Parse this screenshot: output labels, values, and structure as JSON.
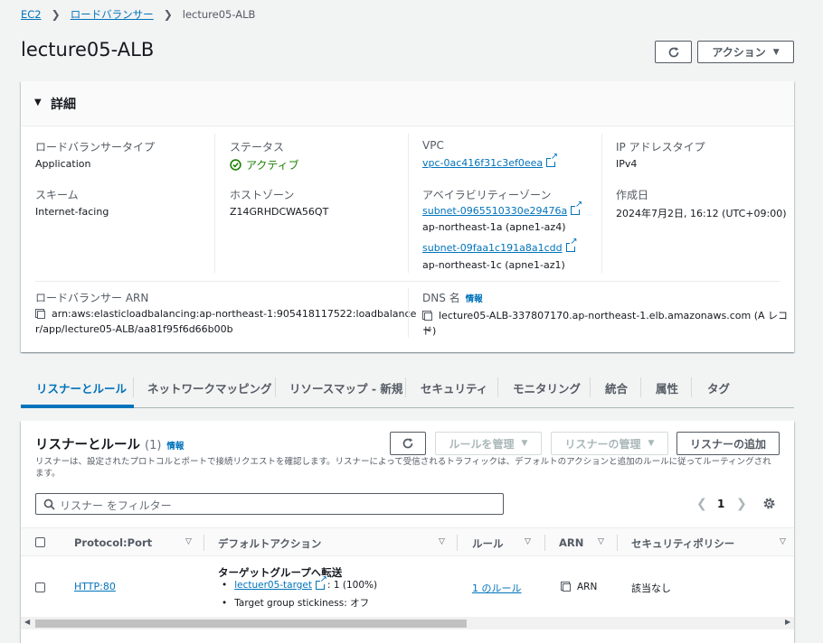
{
  "breadcrumb": {
    "items": [
      "EC2",
      "ロードバランサー"
    ],
    "current": "lecture05-ALB"
  },
  "page": {
    "title": "lecture05-ALB",
    "action_label": "アクション"
  },
  "details": {
    "section_title": "詳細",
    "lb_type_label": "ロードバランサータイプ",
    "lb_type": "Application",
    "status_label": "ステータス",
    "status": "アクティブ",
    "vpc_label": "VPC",
    "vpc": "vpc-0ac416f31c3ef0eea",
    "ip_type_label": "IP アドレスタイプ",
    "ip_type": "IPv4",
    "scheme_label": "スキーム",
    "scheme": "Internet-facing",
    "hosted_zone_label": "ホストゾーン",
    "hosted_zone": "Z14GRHDCWA56QT",
    "az_label": "アベイラビリティーゾーン",
    "subnet1": "subnet-0965510330e29476a",
    "subnet1_az": "ap-northeast-1a (apne1-az4)",
    "subnet2": "subnet-09faa1c191a8a1cdd",
    "subnet2_az": "ap-northeast-1c (apne1-az1)",
    "created_label": "作成日",
    "created": "2024年7月2日, 16:12 (UTC+09:00)",
    "arn_label": "ロードバランサー ARN",
    "arn_line1": "arn:aws:elasticloadbalancing:ap-northeast-1:905418117522:loadbalance",
    "arn_line2": "r/app/lecture05-ALB/aa81f95f6d66b00b",
    "dns_label": "DNS 名",
    "dns_info": "情報",
    "dns_line1": "lecture05-ALB-337807170.ap-northeast-1.elb.amazonaws.com (A レコー",
    "dns_line2": "ド)"
  },
  "tabs": [
    "リスナーとルール",
    "ネットワークマッピング",
    "リソースマップ - 新規",
    "セキュリティ",
    "モニタリング",
    "統合",
    "属性",
    "タグ"
  ],
  "listeners": {
    "title": "リスナーとルール",
    "count": "(1)",
    "info": "情報",
    "manage_rules": "ルールを管理",
    "manage_listener": "リスナーの管理",
    "add_listener": "リスナーの追加",
    "description_line1": "リスナーは、設定されたプロトコルとポートで接続リクエストを確認します。リスナーによって受信されるトラフィックは、デフォルトのアクションと追加のルールに従ってルーティングされ",
    "description_line2": "ます。",
    "search_placeholder": "リスナー をフィルター",
    "page_number": "1",
    "columns": [
      "Protocol:Port",
      "デフォルトアクション",
      "ルール",
      "ARN",
      "セキュリティポリシー"
    ],
    "row": {
      "protocol_port": "HTTP:80",
      "action_title": "ターゲットグループへ転送",
      "target": "lectuer05-target",
      "target_weight": ": 1 (100%)",
      "stickiness": "Target group stickiness: オフ",
      "rules": "1 のルール",
      "arn": "ARN",
      "security_policy": "該当なし"
    }
  }
}
